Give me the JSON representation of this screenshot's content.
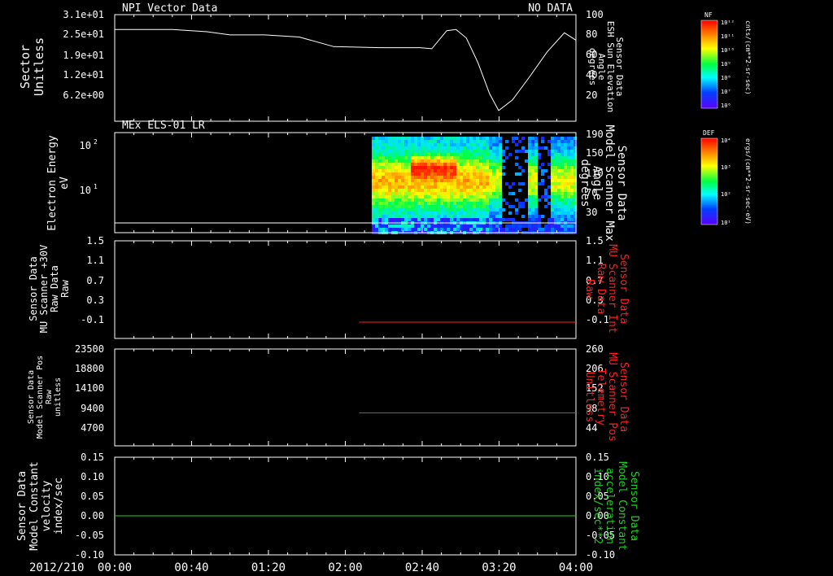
{
  "colors": {
    "background": "#000000",
    "axis": "#ffffff",
    "red": "#ff2020",
    "green": "#20d020",
    "white_trace": "#ffffff"
  },
  "x_axis": {
    "date_label": "2012/210",
    "ticks": [
      "00:00",
      "00:40",
      "01:20",
      "02:00",
      "02:40",
      "03:20",
      "04:00"
    ]
  },
  "panels": [
    {
      "title_left": "NPI Vector Data",
      "title_right": "NO DATA",
      "left_label": [
        "Sector",
        "Unitless"
      ],
      "left_ticks": [
        "3.1e+01",
        "2.5e+01",
        "1.9e+01",
        "1.2e+01",
        "6.2e+00"
      ],
      "right_ticks": [
        "100",
        "80",
        "60",
        "40",
        "20"
      ],
      "right_label": [
        "Sensor Data",
        "ESH Sun Elevation",
        "Angle",
        "degrees"
      ]
    },
    {
      "title_left": "MEx ELS-01 LR",
      "left_label": [
        "Electron Energy",
        "eV"
      ],
      "left_ticks": [
        "10",
        "10",
        "2",
        "1"
      ],
      "right_ticks": [
        "190",
        "150",
        "110",
        "70",
        "30"
      ],
      "right_label": [
        "Sensor Data",
        "Model Scanner Max",
        "Angle",
        "degrees"
      ]
    },
    {
      "left_label": [
        "Sensor Data",
        "MU Scanner +30V",
        "Raw Data",
        "Raw"
      ],
      "left_ticks": [
        "1.5",
        "1.1",
        "0.7",
        "0.3",
        "-0.1"
      ],
      "right_ticks": [
        "1.5",
        "1.1",
        "0.7",
        "0.3",
        "-0.1"
      ],
      "right_label": [
        "Sensor Data",
        "MU Scanner Int",
        "Raw Data",
        "Raw"
      ]
    },
    {
      "left_label": [
        "Sensor Data",
        "Model Scanner Pos",
        "Raw",
        "unitless"
      ],
      "left_ticks": [
        "23500",
        "18800",
        "14100",
        "9400",
        "4700"
      ],
      "right_ticks": [
        "260",
        "206",
        "152",
        "98",
        "44"
      ],
      "right_label": [
        "Sensor Data",
        "MU Scanner Pos",
        "Telemetry",
        "Unitless"
      ]
    },
    {
      "left_label": [
        "Sensor Data",
        "Model Constant",
        "velocity",
        "index/sec"
      ],
      "left_ticks": [
        "0.15",
        "0.10",
        "0.05",
        "0.00",
        "-0.05",
        "-0.10"
      ],
      "right_ticks": [
        "0.15",
        "0.10",
        "0.05",
        "0.00",
        "-0.05",
        "-0.10"
      ],
      "right_label": [
        "Sensor Data",
        "Model Constant",
        "acceleration",
        "index/sec**2"
      ]
    }
  ],
  "colorbars": [
    {
      "tag": "NF",
      "ticks": [
        "10¹²",
        "10¹¹",
        "10¹⁰",
        "10⁹",
        "10⁸",
        "10⁷",
        "10⁶"
      ],
      "label": "cnts/(cm**2-sr-sec)"
    },
    {
      "tag": "DEF",
      "ticks": [
        "10⁴",
        "10³",
        "10²",
        "10¹"
      ],
      "label": "ergs/(cm**2-sr-sec-eV)"
    }
  ],
  "chart_data": [
    {
      "type": "line",
      "x_unit": "hours since 2012/210 00:00",
      "xlim": [
        0,
        4
      ],
      "right_ylim": [
        0,
        100
      ],
      "series": [
        {
          "x": [
            0,
            0.5,
            0.8,
            1.0,
            1.3,
            1.6,
            1.9,
            2.3,
            2.65,
            2.75,
            2.88,
            2.96,
            3.05,
            3.15,
            3.25,
            3.33,
            3.45,
            3.6,
            3.75,
            3.9,
            4.0
          ],
          "y": [
            86,
            86,
            84,
            81,
            81,
            79,
            70,
            69,
            69,
            68,
            85,
            86,
            78,
            55,
            26,
            10,
            20,
            42,
            65,
            83,
            76
          ]
        }
      ]
    },
    {
      "type": "heatmap",
      "description_axes": "time vs electron energy (eV), log scale",
      "xlim": [
        0,
        4
      ],
      "data_start": 2.2
    },
    {
      "type": "line",
      "xlim": [
        0,
        4
      ],
      "ylim": [
        -0.3,
        1.5
      ],
      "series": [
        {
          "x": [
            2.12,
            4.0
          ],
          "y": [
            0.0,
            0.0
          ]
        }
      ]
    },
    {
      "type": "line",
      "xlim": [
        0,
        4
      ],
      "ylim": [
        0,
        23500
      ],
      "series": [
        {
          "x": [
            2.12,
            4.0
          ],
          "y": [
            8000,
            8000
          ]
        }
      ]
    },
    {
      "type": "line",
      "xlim": [
        0,
        4
      ],
      "ylim": [
        -0.1,
        0.15
      ],
      "series": [
        {
          "x": [
            0,
            4.0
          ],
          "y": [
            0.0,
            0.0
          ]
        }
      ]
    }
  ]
}
